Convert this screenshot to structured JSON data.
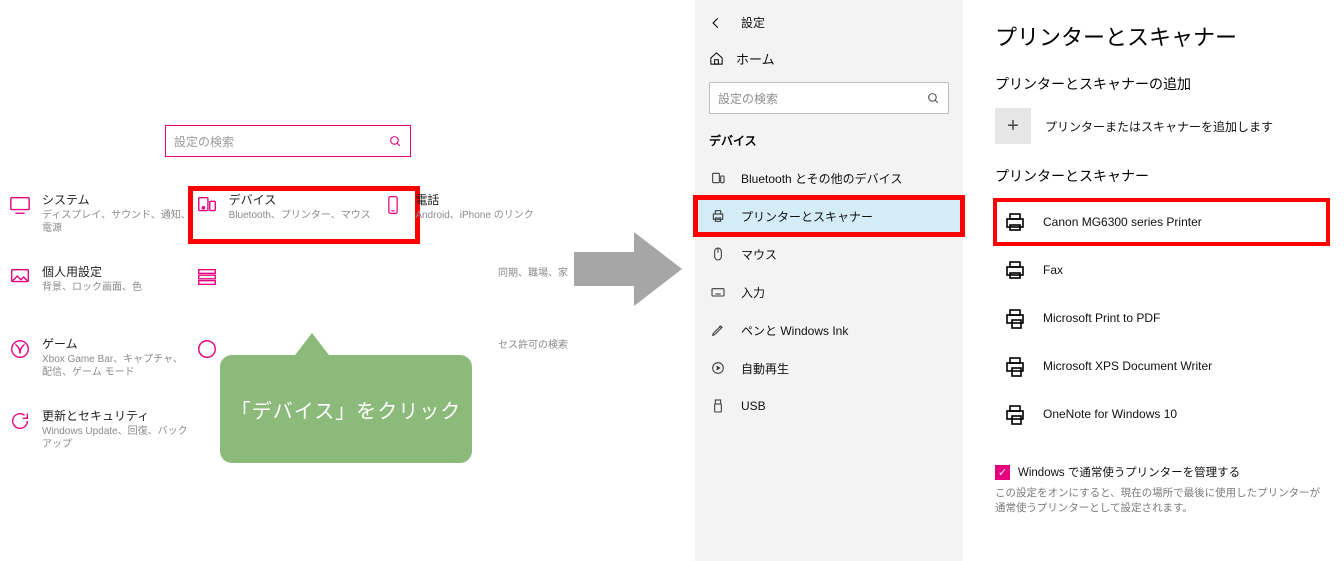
{
  "left": {
    "search_placeholder": "設定の検索",
    "categories": [
      {
        "id": "system",
        "title": "システム",
        "sub": "ディスプレイ、サウンド、通知、電源"
      },
      {
        "id": "devices",
        "title": "デバイス",
        "sub": "Bluetooth、プリンター、マウス"
      },
      {
        "id": "phone",
        "title": "電話",
        "sub": "Android、iPhone のリンク"
      },
      {
        "id": "personalization",
        "title": "個人用設定",
        "sub": "背景、ロック画面、色"
      },
      {
        "id": "apps-partial",
        "title": "",
        "sub": "同期、職場、家"
      },
      {
        "id": "gaming",
        "title": "ゲーム",
        "sub": "Xbox Game Bar、キャプチャ、配信、ゲーム モード"
      },
      {
        "id": "privacy-partial",
        "title": "",
        "sub": "セス許可の検索"
      },
      {
        "id": "update",
        "title": "更新とセキュリティ",
        "sub": "Windows Update、回復、バックアップ"
      }
    ],
    "callout": "「デバイス」をクリック"
  },
  "right": {
    "header": "設定",
    "home": "ホーム",
    "search_placeholder": "設定の検索",
    "section_title": "デバイス",
    "sidebar_items": [
      {
        "id": "bluetooth",
        "label": "Bluetooth とその他のデバイス"
      },
      {
        "id": "printers",
        "label": "プリンターとスキャナー"
      },
      {
        "id": "mouse",
        "label": "マウス"
      },
      {
        "id": "typing",
        "label": "入力"
      },
      {
        "id": "pen",
        "label": "ペンと Windows Ink"
      },
      {
        "id": "autoplay",
        "label": "自動再生"
      },
      {
        "id": "usb",
        "label": "USB"
      }
    ],
    "content": {
      "page_title": "プリンターとスキャナー",
      "add_section_title": "プリンターとスキャナーの追加",
      "add_label": "プリンターまたはスキャナーを追加します",
      "list_section_title": "プリンターとスキャナー",
      "printers": [
        {
          "id": "canon",
          "label": "Canon MG6300 series Printer"
        },
        {
          "id": "fax",
          "label": "Fax"
        },
        {
          "id": "mspdf",
          "label": "Microsoft Print to PDF"
        },
        {
          "id": "msxps",
          "label": "Microsoft XPS Document Writer"
        },
        {
          "id": "onenote",
          "label": "OneNote for Windows 10"
        }
      ],
      "manage_label": "Windows で通常使うプリンターを管理する",
      "manage_note": "この設定をオンにすると、現在の場所で最後に使用したプリンターが通常使うプリンターとして設定されます。"
    }
  }
}
